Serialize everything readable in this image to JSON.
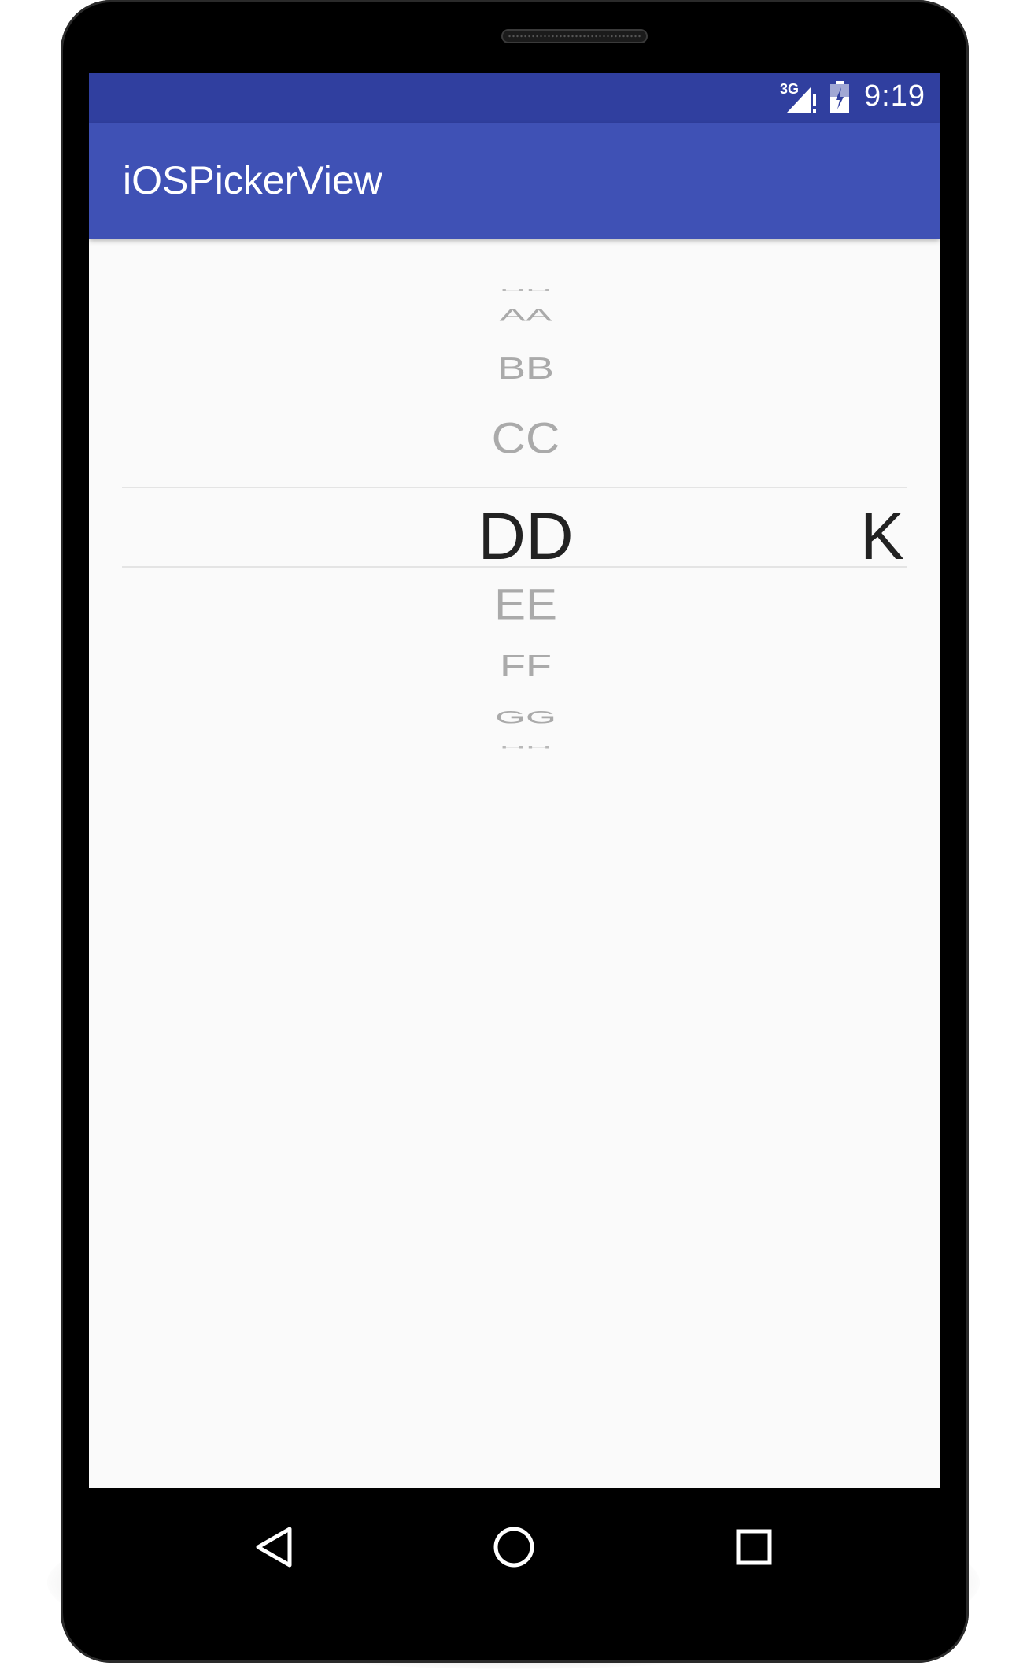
{
  "status_bar": {
    "network": "3G",
    "time": "9:19",
    "icons": [
      "signal-icon",
      "battery-icon"
    ]
  },
  "app_bar": {
    "title": "iOSPickerView"
  },
  "picker": {
    "items_above": [
      "HH",
      "AA",
      "BB",
      "CC"
    ],
    "selected": "DD",
    "selected_right": "K",
    "items_below": [
      "EE",
      "FF",
      "GG",
      "HH"
    ]
  },
  "navigation": {
    "icons": [
      "back-icon",
      "home-icon",
      "recents-icon"
    ]
  },
  "colors": {
    "status_bar": "#303f9f",
    "app_bar": "#3f51b5",
    "screen_bg": "#fafafa"
  }
}
